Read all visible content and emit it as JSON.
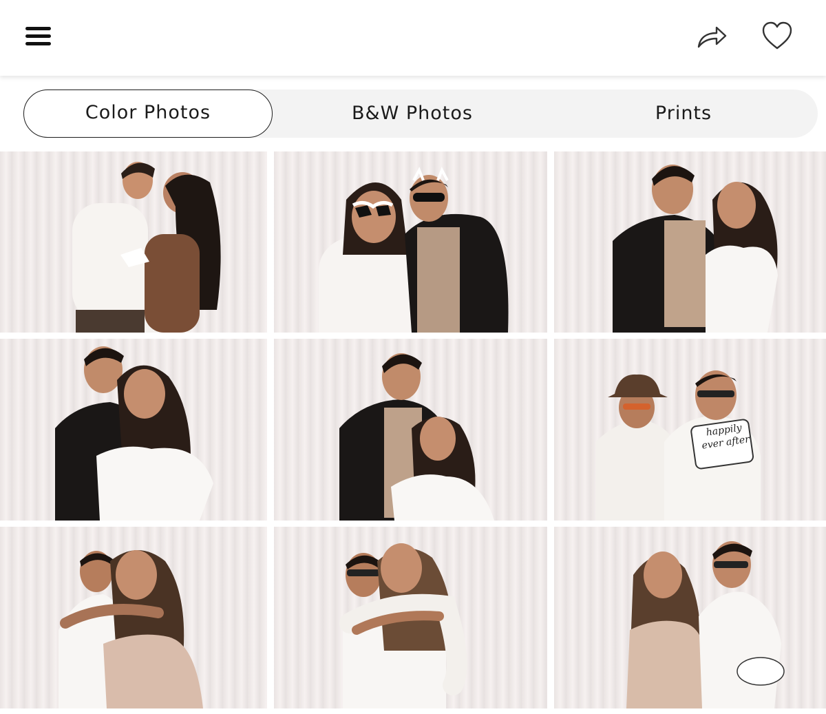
{
  "header": {
    "menu_icon": "hamburger-menu-icon",
    "share_icon": "share-arrow-icon",
    "favorite_icon": "heart-outline-icon"
  },
  "tabs": [
    {
      "label": "Color Photos",
      "active": true
    },
    {
      "label": "B&W Photos",
      "active": false
    },
    {
      "label": "Prints",
      "active": false
    }
  ],
  "photos": [
    {
      "subject": "couple-kiss",
      "prop_text": ""
    },
    {
      "subject": "couple-heart-sunglasses",
      "prop_text": ""
    },
    {
      "subject": "couple-smiling",
      "prop_text": ""
    },
    {
      "subject": "couple-embrace",
      "prop_text": ""
    },
    {
      "subject": "couple-pointing",
      "prop_text": ""
    },
    {
      "subject": "two-men-with-sign",
      "prop_text": "happily ever after"
    },
    {
      "subject": "couple-hug",
      "prop_text": ""
    },
    {
      "subject": "couple-piggyback",
      "prop_text": ""
    },
    {
      "subject": "couple-satin-dress",
      "prop_text": ""
    }
  ],
  "colors": {
    "backdrop": "#efe9e8",
    "tab_bar": "#f3f3f3",
    "text": "#1a1a1a"
  }
}
